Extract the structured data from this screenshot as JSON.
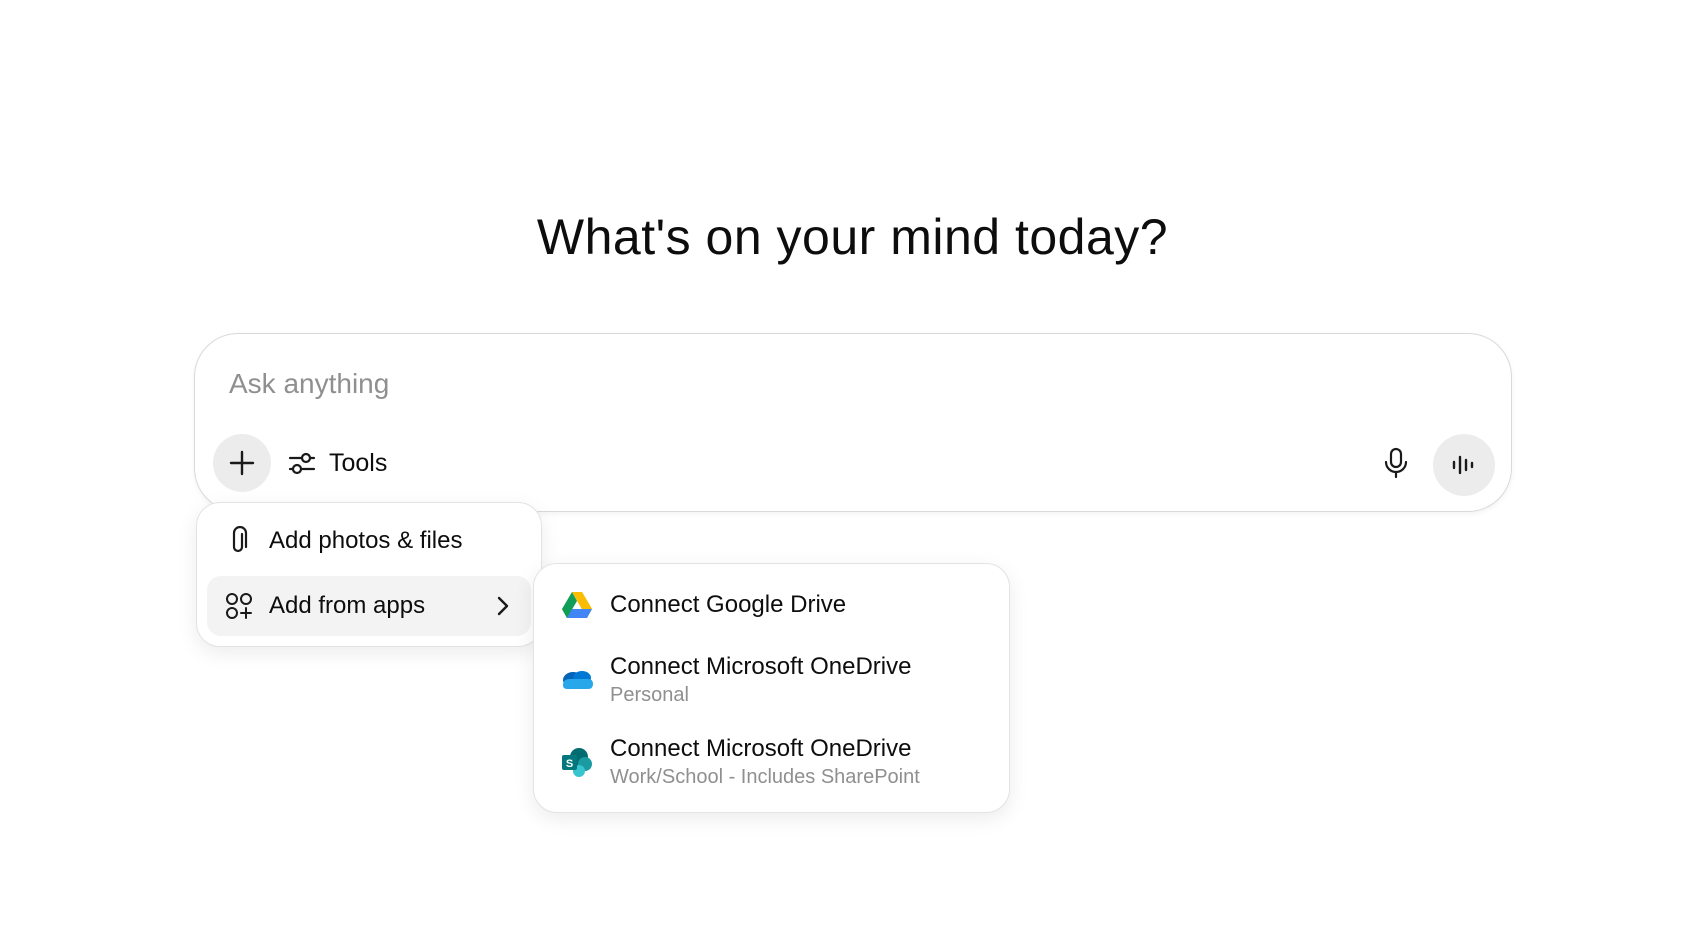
{
  "headline": "What's on your mind today?",
  "composer": {
    "placeholder": "Ask anything",
    "value": "",
    "tools_label": "Tools"
  },
  "attach_menu": {
    "items": [
      {
        "label": "Add photos & files",
        "icon": "paperclip-icon"
      },
      {
        "label": "Add from apps",
        "icon": "apps-icon",
        "has_submenu": true
      }
    ]
  },
  "apps_submenu": {
    "items": [
      {
        "title": "Connect Google Drive",
        "subtitle": "",
        "icon": "google-drive-icon"
      },
      {
        "title": "Connect Microsoft OneDrive",
        "subtitle": "Personal",
        "icon": "onedrive-icon"
      },
      {
        "title": "Connect Microsoft OneDrive",
        "subtitle": "Work/School - Includes SharePoint",
        "icon": "sharepoint-icon"
      }
    ]
  },
  "colors": {
    "text": "#0d0d0d",
    "muted": "#8f8f8f",
    "button_bg": "#ececec",
    "border": "#d9d9d9"
  }
}
